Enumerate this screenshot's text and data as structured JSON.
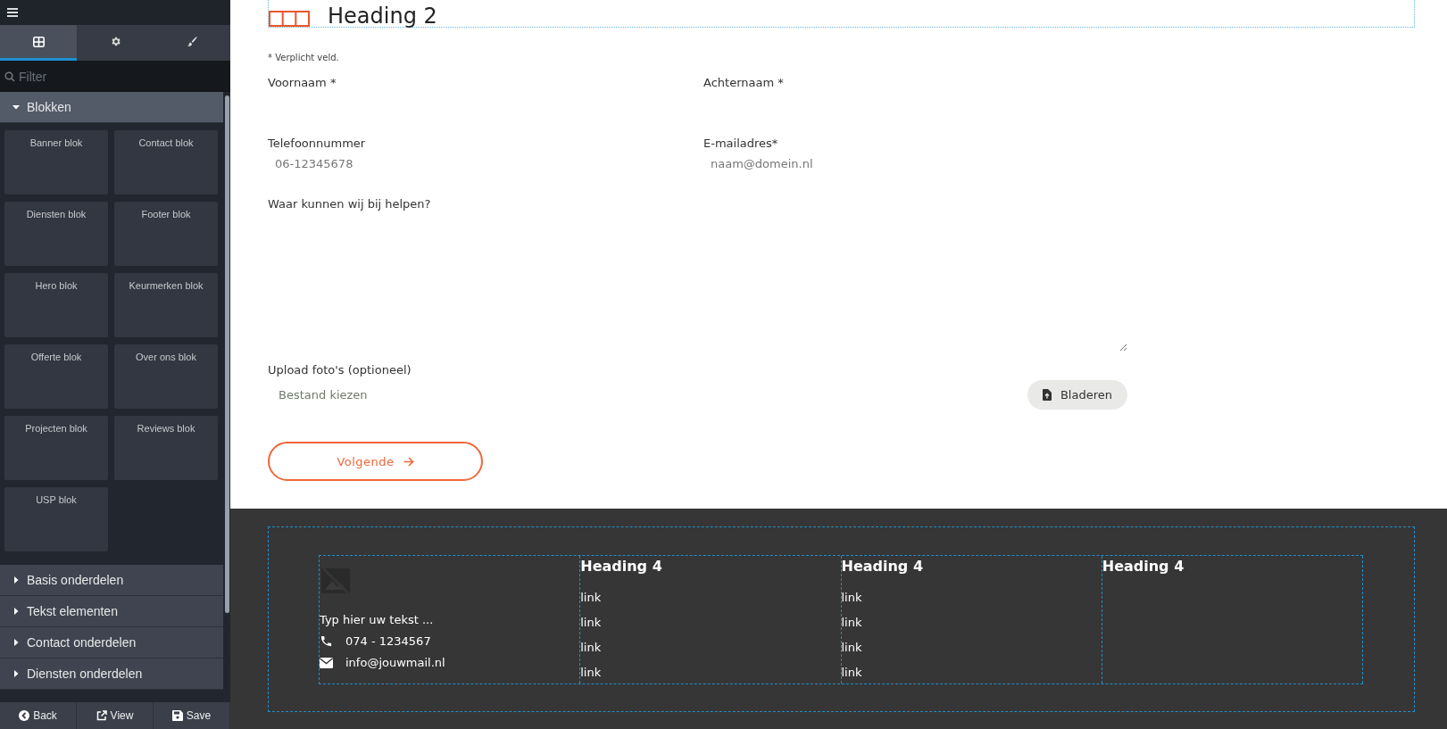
{
  "sidebar": {
    "tabs": [
      {
        "selected": true
      },
      {
        "selected": false
      },
      {
        "selected": false
      }
    ],
    "filter": {
      "placeholder": "Filter"
    },
    "sections": [
      {
        "label": "Blokken",
        "expanded": true,
        "items": [
          "Banner blok",
          "Contact blok",
          "Diensten blok",
          "Footer blok",
          "Hero blok",
          "Keurmerken blok",
          "Offerte blok",
          "Over ons blok",
          "Projecten blok",
          "Reviews blok",
          "USP blok"
        ]
      },
      {
        "label": "Basis onderdelen",
        "expanded": false
      },
      {
        "label": "Tekst elementen",
        "expanded": false
      },
      {
        "label": "Contact onderdelen",
        "expanded": false
      },
      {
        "label": "Diensten onderdelen",
        "expanded": false
      }
    ],
    "footer_buttons": [
      "Back",
      "View",
      "Save"
    ]
  },
  "editor": {
    "heading": "Heading 2",
    "required_note": "* Verplicht veld.",
    "fields": [
      {
        "kind": "text",
        "label": "Voornaam *"
      },
      {
        "kind": "text",
        "label": "Achternaam *"
      },
      {
        "kind": "text",
        "label": "Telefoonnummer",
        "placeholder": "06-12345678"
      },
      {
        "kind": "text",
        "label": "E-mailadres*",
        "placeholder": "naam@domein.nl"
      },
      {
        "kind": "textarea",
        "label": "Waar kunnen wij bij helpen?"
      },
      {
        "kind": "file",
        "label": "Upload foto's (optioneel)",
        "placeholder": "Bestand kiezen",
        "button": "Bladeren"
      }
    ],
    "next_button": "Volgende"
  },
  "footer": {
    "text": "Typ hier uw tekst ...",
    "phone": "074 - 1234567",
    "email": "info@jouwmail.nl",
    "columns": [
      {
        "heading": "Heading 4",
        "links": [
          "link",
          "link",
          "link",
          "link"
        ]
      },
      {
        "heading": "Heading 4",
        "links": [
          "link",
          "link",
          "link",
          "link"
        ]
      },
      {
        "heading": "Heading 4"
      }
    ]
  }
}
